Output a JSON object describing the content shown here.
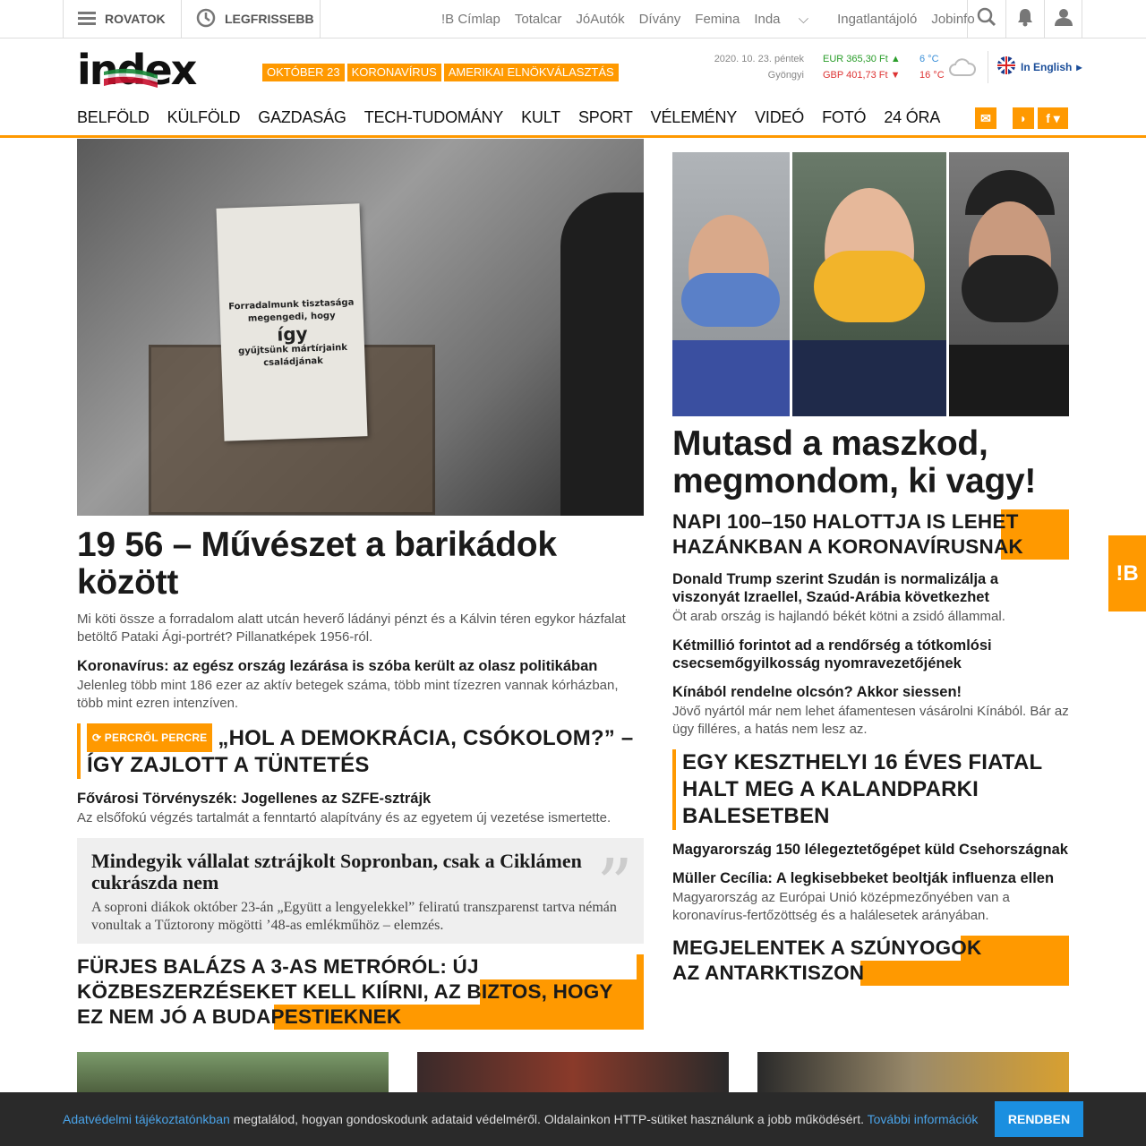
{
  "topbar": {
    "rovatok": "ROVATOK",
    "legfrissebb": "LEGFRISSEBB",
    "partners": [
      "!B Címlap",
      "Totalcar",
      "JóAutók",
      "Dívány",
      "Femina",
      "Inda",
      "Ingatlantájoló",
      "Jobinfo"
    ]
  },
  "header": {
    "logo": "index",
    "tags": [
      "OKTÓBER 23",
      "KORONAVÍRUS",
      "AMERIKAI ELNÖKVÁLASZTÁS"
    ],
    "date": "2020. 10. 23. péntek",
    "nameday": "Gyöngyi",
    "eur": "EUR 365,30 Ft",
    "gbp": "GBP 401,73 Ft",
    "temp_low": "6 °C",
    "temp_high": "16 °C",
    "lang": "In English"
  },
  "nav": [
    "BELFÖLD",
    "KÜLFÖLD",
    "GAZDASÁG",
    "TECH-TUDOMÁNY",
    "KULT",
    "SPORT",
    "VÉLEMÉNY",
    "VIDEÓ",
    "FOTÓ",
    "24 ÓRA"
  ],
  "left": {
    "poster_text1": "Forradalmunk tisztasága megengedi, hogy",
    "poster_text2": "így",
    "poster_text3": "gyűjtsünk mártírjaink családjának",
    "h1": "19 56 – Művészet a barikádok között",
    "lead": "Mi köti össze a forradalom alatt utcán heverő ládányi pénzt és a Kálvin téren egykor házfalat betöltő Pataki Ági-portrét? Pillanatképek 1956-ról.",
    "s1_t": "Koronavírus: az egész ország lezárása is szóba került az olasz politikában",
    "s1_l": "Jelenleg több mint 186 ezer az aktív betegek száma, több mint tízezren vannak kórházban, több mint ezren intenzíven.",
    "live_badge": "⟳ PERCRŐL PERCRE",
    "live_t": "„HOL A DEMOKRÁCIA, CSÓKOLOM?” – ÍGY ZAJLOTT A TÜNTETÉS",
    "s2_t": "Fővárosi Törvényszék: Jogellenes az SZFE-sztrájk",
    "s2_l": "Az elsőfokú végzés tartalmát a fenntartó alapítvány és az egyetem új vezetése ismertette.",
    "q_t": "Mindegyik vállalat sztrájkolt Sopronban, csak a Ciklámen cukrászda nem",
    "q_l": "A soproni diákok október 23-án „Együtt a lengyelekkel” feliratú transzparenst tartva némán vonultak a Tűztorony mögötti ’48-as emlékműhöz – elemzés.",
    "box_t": "FÜRJES BALÁZS A 3-AS METRÓRÓL: ÚJ KÖZBESZERZÉSEKET KELL KIÍRNI, AZ BIZTOS, HOGY EZ NEM JÓ A BUDAPESTIEKNEK"
  },
  "right": {
    "h1": "Mutasd a maszkod, megmondom, ki vagy!",
    "box1": "NAPI 100–150 HALOTTJA IS LEHET HAZÁNKBAN A KORONAVÍRUSNAK",
    "s1_t": "Donald Trump szerint Szudán is normalizálja a viszonyát Izraellel, Szaúd-Arábia következhet",
    "s1_l": "Öt arab ország is hajlandó békét kötni a zsidó állammal.",
    "s2_t": "Kétmillió forintot ad a rendőrség a tótkomlósi csecsemőgyilkosság nyomravezetőjének",
    "s3_t": "Kínából rendelne olcsón? Akkor siessen!",
    "s3_l": "Jövő nyártól már nem lehet áfamentesen vásárolni Kínából. Bár az ügy filléres, a hatás nem lesz az.",
    "cap2": "EGY KESZTHELYI 16 ÉVES FIATAL HALT MEG A KALANDPARKI BALESETBEN",
    "s4_t": "Magyarország 150 lélegeztetőgépet küld Csehországnak",
    "s5_t": "Müller Cecília: A legkisebbeket beoltják influenza ellen",
    "s5_l": "Magyarország az Európai Unió középmezőnyében van a koronavírus-fertőzöttség és a halálesetek arányában.",
    "box2": "MEGJELENTEK A SZÚNYOGOK AZ ANTARKTISZON"
  },
  "ib_tab": "!B",
  "cookie": {
    "link1": "Adatvédelmi tájékoztatónkban",
    "text": " megtalálod, hogyan gondoskodunk adataid védelméről. Oldalainkon HTTP-sütiket használunk a jobb működésért. ",
    "link2": "További információk",
    "ok": "RENDBEN"
  }
}
